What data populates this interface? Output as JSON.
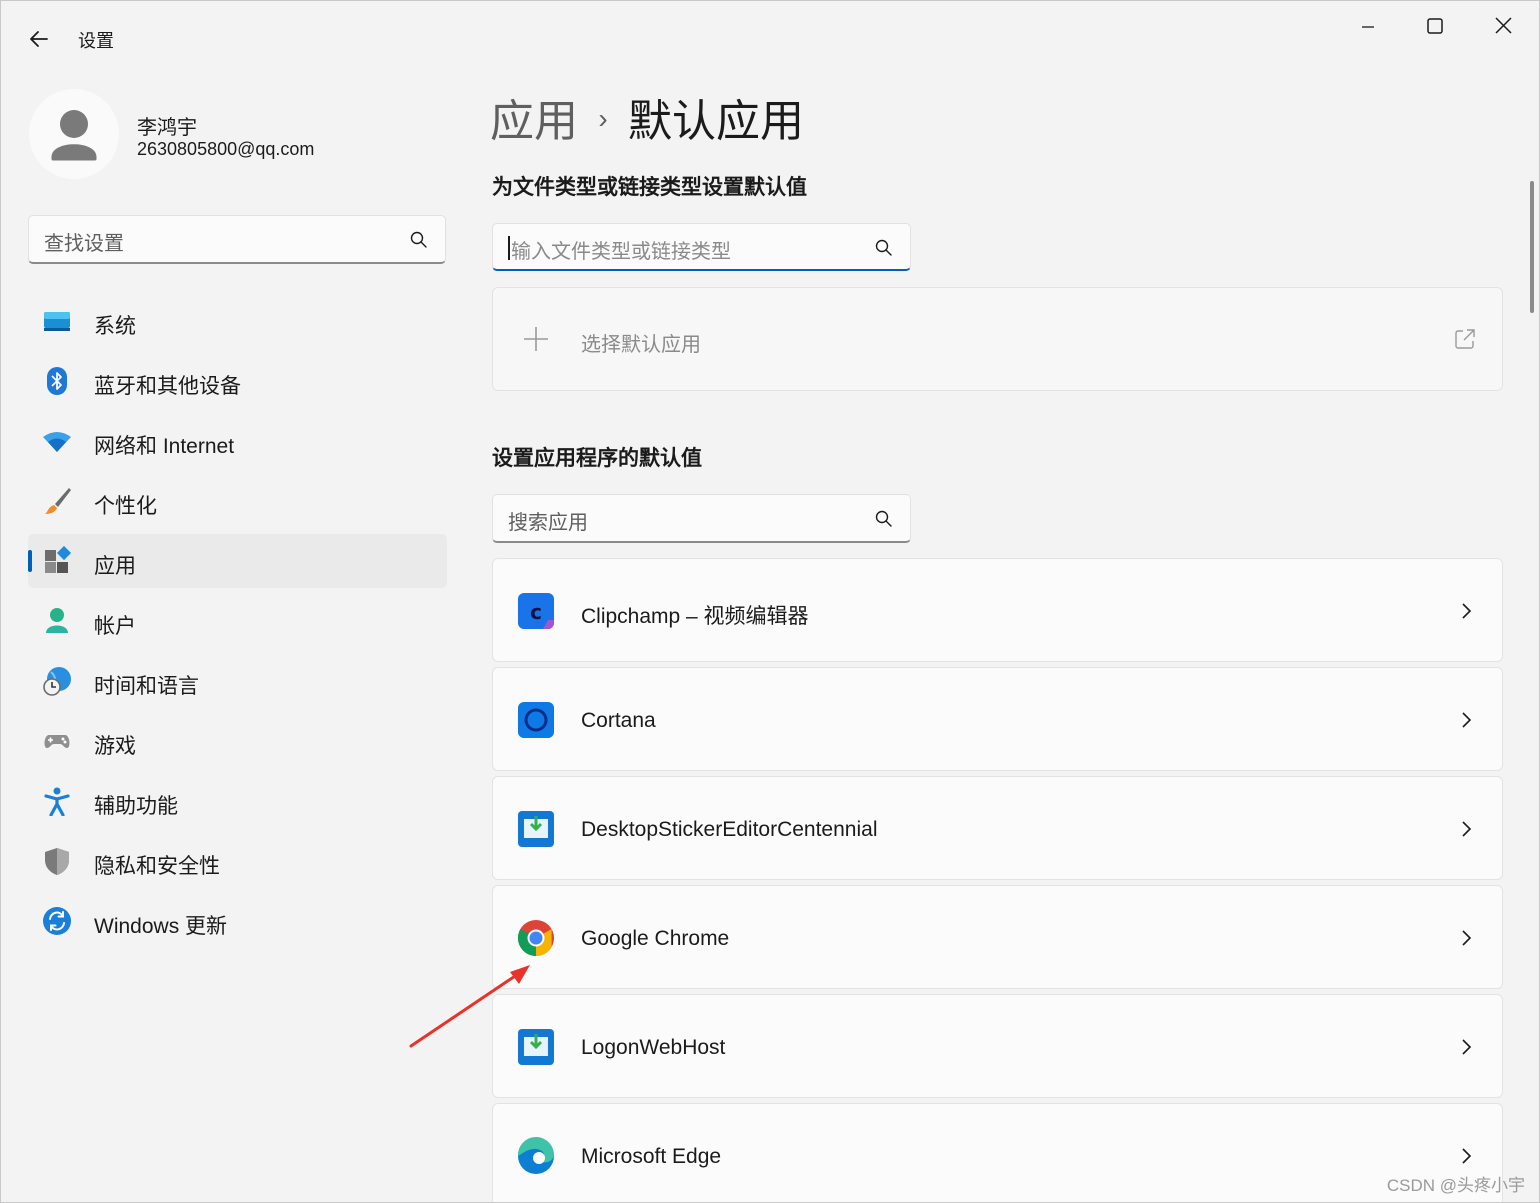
{
  "window": {
    "title": "设置",
    "controls": {
      "minimize": "minimize-icon",
      "maximize": "maximize-icon",
      "close": "close-icon"
    }
  },
  "profile": {
    "name": "李鸿宇",
    "email": "2630805800@qq.com"
  },
  "sidebar": {
    "search_placeholder": "查找设置",
    "items": [
      {
        "label": "系统",
        "icon": "system-icon"
      },
      {
        "label": "蓝牙和其他设备",
        "icon": "bluetooth-icon"
      },
      {
        "label": "网络和 Internet",
        "icon": "wifi-icon"
      },
      {
        "label": "个性化",
        "icon": "brush-icon"
      },
      {
        "label": "应用",
        "icon": "apps-icon",
        "selected": true
      },
      {
        "label": "帐户",
        "icon": "account-icon"
      },
      {
        "label": "时间和语言",
        "icon": "globe-clock-icon"
      },
      {
        "label": "游戏",
        "icon": "gamepad-icon"
      },
      {
        "label": "辅助功能",
        "icon": "accessibility-icon"
      },
      {
        "label": "隐私和安全性",
        "icon": "shield-icon"
      },
      {
        "label": "Windows 更新",
        "icon": "update-icon"
      }
    ]
  },
  "breadcrumb": {
    "parent": "应用",
    "separator": "›",
    "current": "默认应用"
  },
  "filetypes": {
    "title": "为文件类型或链接类型设置默认值",
    "search_placeholder": "输入文件类型或链接类型",
    "choose_label": "选择默认应用"
  },
  "apps": {
    "title": "设置应用程序的默认值",
    "search_placeholder": "搜索应用",
    "items": [
      {
        "name": "Clipchamp – 视频编辑器",
        "icon": "clipchamp-icon"
      },
      {
        "name": "Cortana",
        "icon": "cortana-icon"
      },
      {
        "name": "DesktopStickerEditorCentennial",
        "icon": "download-box-icon"
      },
      {
        "name": "Google Chrome",
        "icon": "chrome-icon"
      },
      {
        "name": "LogonWebHost",
        "icon": "download-box-icon"
      },
      {
        "name": "Microsoft Edge",
        "icon": "edge-icon"
      }
    ]
  },
  "watermark": "CSDN @头疼小宇",
  "colors": {
    "accent": "#005fb8",
    "background": "#f3f3f3",
    "card": "#fbfbfb",
    "arrow": "#e8322a"
  }
}
